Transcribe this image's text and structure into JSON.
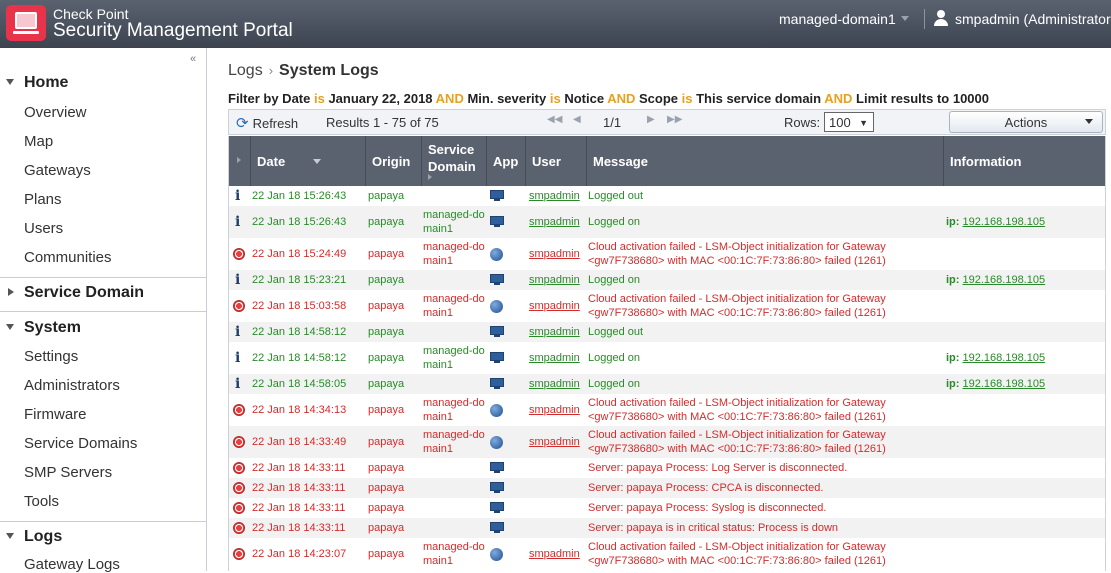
{
  "header": {
    "brand_small": "Check Point",
    "brand_big": "Security Management Portal",
    "domain": "managed-domain1",
    "user": "smpadmin (Administrator"
  },
  "sidebar": {
    "sections": [
      {
        "label": "Home",
        "expanded": true,
        "items": [
          "Overview",
          "Map",
          "Gateways",
          "Plans",
          "Users",
          "Communities"
        ]
      },
      {
        "label": "Service Domain",
        "expanded": false,
        "items": []
      },
      {
        "label": "System",
        "expanded": true,
        "items": [
          "Settings",
          "Administrators",
          "Firmware",
          "Service Domains",
          "SMP Servers",
          "Tools"
        ]
      },
      {
        "label": "Logs",
        "expanded": true,
        "items": [
          "Gateway Logs"
        ]
      }
    ]
  },
  "breadcrumb": {
    "root": "Logs",
    "sep": "›",
    "current": "System Logs"
  },
  "filter": {
    "parts": [
      "Filter by Date",
      "is",
      "January 22, 2018",
      "AND",
      "Min. severity",
      "is",
      "Notice",
      "AND",
      "Scope",
      "is",
      "This service domain",
      "AND",
      "Limit results to 10000"
    ]
  },
  "toolbar": {
    "refresh": "Refresh",
    "results": "Results 1 - 75 of 75",
    "page": "1/1",
    "rows_label": "Rows:",
    "rows_value": "100",
    "actions": "Actions"
  },
  "table": {
    "columns": [
      "Date",
      "Origin",
      "Service Domain",
      "App",
      "User",
      "Message",
      "Information"
    ],
    "rows": [
      {
        "sev": "info",
        "date": "22 Jan 18 15:26:43",
        "origin": "papaya",
        "domain": "",
        "app": "monitor",
        "user": "smpadmin",
        "message": "Logged out",
        "ip": ""
      },
      {
        "sev": "info",
        "date": "22 Jan 18 15:26:43",
        "origin": "papaya",
        "domain": "managed-domain1",
        "app": "monitor",
        "user": "smpadmin",
        "message": "Logged on",
        "ip": "192.168.198.105"
      },
      {
        "sev": "crit",
        "date": "22 Jan 18 15:24:49",
        "origin": "papaya",
        "domain": "managed-domain1",
        "app": "globe",
        "user": "smpadmin",
        "message": "Cloud activation failed - LSM-Object initialization for Gateway <gw7F738680> with MAC <00:1C:7F:73:86:80> failed (1261)",
        "ip": ""
      },
      {
        "sev": "info",
        "date": "22 Jan 18 15:23:21",
        "origin": "papaya",
        "domain": "",
        "app": "monitor",
        "user": "smpadmin",
        "message": "Logged on",
        "ip": "192.168.198.105"
      },
      {
        "sev": "crit",
        "date": "22 Jan 18 15:03:58",
        "origin": "papaya",
        "domain": "managed-domain1",
        "app": "globe",
        "user": "smpadmin",
        "message": "Cloud activation failed - LSM-Object initialization for Gateway <gw7F738680> with MAC <00:1C:7F:73:86:80> failed (1261)",
        "ip": ""
      },
      {
        "sev": "info",
        "date": "22 Jan 18 14:58:12",
        "origin": "papaya",
        "domain": "",
        "app": "monitor",
        "user": "smpadmin",
        "message": "Logged out",
        "ip": ""
      },
      {
        "sev": "info",
        "date": "22 Jan 18 14:58:12",
        "origin": "papaya",
        "domain": "managed-domain1",
        "app": "monitor",
        "user": "smpadmin",
        "message": "Logged on",
        "ip": "192.168.198.105"
      },
      {
        "sev": "info",
        "date": "22 Jan 18 14:58:05",
        "origin": "papaya",
        "domain": "",
        "app": "monitor",
        "user": "smpadmin",
        "message": "Logged on",
        "ip": "192.168.198.105"
      },
      {
        "sev": "crit",
        "date": "22 Jan 18 14:34:13",
        "origin": "papaya",
        "domain": "managed-domain1",
        "app": "globe",
        "user": "smpadmin",
        "message": "Cloud activation failed - LSM-Object initialization for Gateway <gw7F738680> with MAC <00:1C:7F:73:86:80> failed (1261)",
        "ip": ""
      },
      {
        "sev": "crit",
        "date": "22 Jan 18 14:33:49",
        "origin": "papaya",
        "domain": "managed-domain1",
        "app": "globe",
        "user": "smpadmin",
        "message": "Cloud activation failed - LSM-Object initialization for Gateway <gw7F738680> with MAC <00:1C:7F:73:86:80> failed (1261)",
        "ip": ""
      },
      {
        "sev": "crit",
        "date": "22 Jan 18 14:33:11",
        "origin": "papaya",
        "domain": "",
        "app": "monitor",
        "user": "",
        "message": "Server: papaya Process: Log Server is disconnected.",
        "ip": ""
      },
      {
        "sev": "crit",
        "date": "22 Jan 18 14:33:11",
        "origin": "papaya",
        "domain": "",
        "app": "monitor",
        "user": "",
        "message": "Server: papaya Process: CPCA is disconnected.",
        "ip": ""
      },
      {
        "sev": "crit",
        "date": "22 Jan 18 14:33:11",
        "origin": "papaya",
        "domain": "",
        "app": "monitor",
        "user": "",
        "message": "Server: papaya Process: Syslog is disconnected.",
        "ip": ""
      },
      {
        "sev": "crit",
        "date": "22 Jan 18 14:33:11",
        "origin": "papaya",
        "domain": "",
        "app": "monitor",
        "user": "",
        "message": "Server: papaya is in critical status: Process is down",
        "ip": ""
      },
      {
        "sev": "crit",
        "date": "22 Jan 18 14:23:07",
        "origin": "papaya",
        "domain": "managed-domain1",
        "app": "globe",
        "user": "smpadmin",
        "message": "Cloud activation failed - LSM-Object initialization for Gateway <gw7F738680> with MAC <00:1C:7F:73:86:80> failed (1261)",
        "ip": ""
      }
    ],
    "ip_label": "ip:"
  },
  "colors": {
    "header": "#4a515d",
    "ok": "#2a8a2a",
    "error": "#d42b2b",
    "keyword": "#e8a020"
  }
}
